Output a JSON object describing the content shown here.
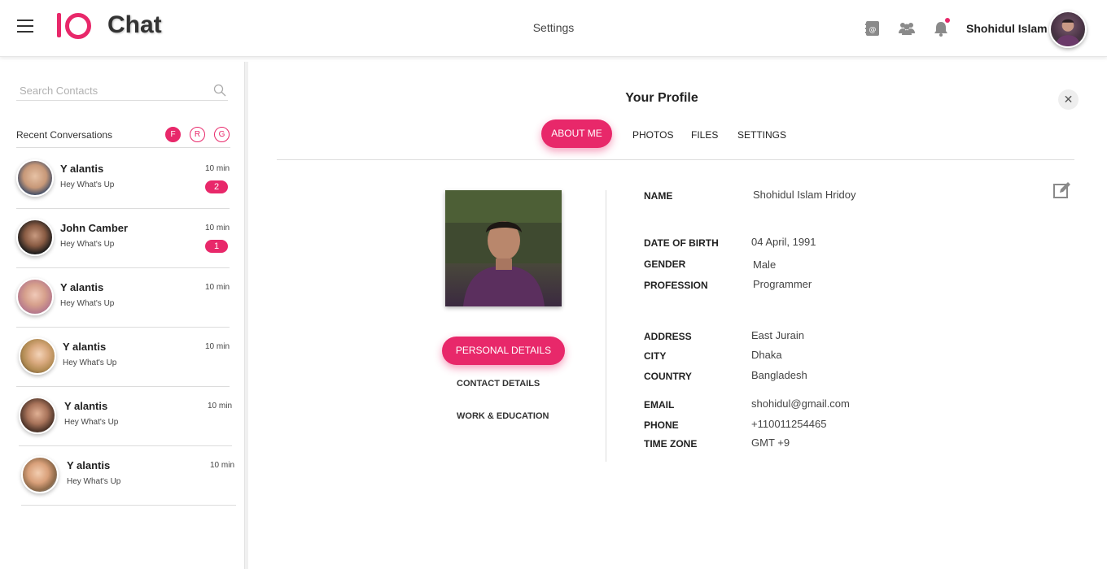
{
  "header": {
    "brand": "Chat",
    "center_title": "Settings",
    "user_name": "Shohidul Islam",
    "accent_color": "#e8286a",
    "icons": [
      "menu-icon",
      "contacts-book-icon",
      "group-icon",
      "bell-icon"
    ]
  },
  "sidebar": {
    "search_placeholder": "Search Contacts",
    "recent_label": "Recent Conversations",
    "filters": [
      "F",
      "R",
      "G"
    ],
    "conversations": [
      {
        "name": "Y alantis",
        "message": "Hey What's Up",
        "time": "10 min",
        "badge": "2"
      },
      {
        "name": "John Camber",
        "message": "Hey What's Up",
        "time": "10 min",
        "badge": "1"
      },
      {
        "name": "Y alantis",
        "message": "Hey What's Up",
        "time": "10 min",
        "badge": ""
      },
      {
        "name": "Y alantis",
        "message": "Hey What's Up",
        "time": "10 min",
        "badge": ""
      },
      {
        "name": "Y alantis",
        "message": "Hey What's Up",
        "time": "10 min",
        "badge": ""
      },
      {
        "name": "Y alantis",
        "message": "Hey What's Up",
        "time": "10 min",
        "badge": ""
      }
    ]
  },
  "profile": {
    "title": "Your Profile",
    "close": "✕",
    "tabs": {
      "active": "ABOUT ME",
      "photos": "PHOTOS",
      "files": "FILES",
      "settings": "SETTINGS"
    },
    "sections": {
      "personal": "PERSONAL DETAILS",
      "contact": "CONTACT DETAILS",
      "work": "WORK & EDUCATION"
    },
    "fields": {
      "name": {
        "label": "NAME",
        "value": "Shohidul Islam Hridoy"
      },
      "dob": {
        "label": "DATE OF BIRTH",
        "value": "04 April, 1991"
      },
      "gender": {
        "label": "GENDER",
        "value": "Male"
      },
      "profession": {
        "label": "PROFESSION",
        "value": "Programmer"
      },
      "address": {
        "label": "ADDRESS",
        "value": "East Jurain"
      },
      "city": {
        "label": "CITY",
        "value": "Dhaka"
      },
      "country": {
        "label": "COUNTRY",
        "value": "Bangladesh"
      },
      "email": {
        "label": "EMAIL",
        "value": "shohidul@gmail.com"
      },
      "phone": {
        "label": "PHONE",
        "value": "+110011254465"
      },
      "timezone": {
        "label": "TIME ZONE",
        "value": "GMT +9"
      }
    }
  }
}
